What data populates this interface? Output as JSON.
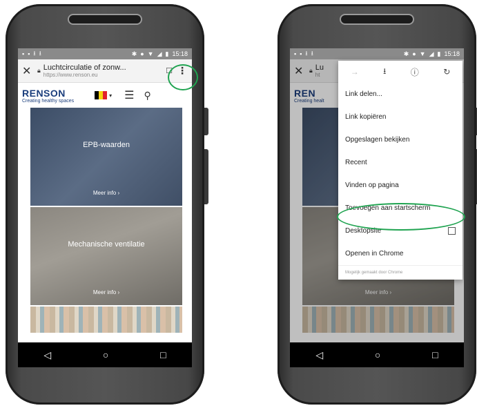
{
  "left": {
    "status": {
      "time": "15:18"
    },
    "urlbar": {
      "title": "Luchtcirculatie of zonw...",
      "host": "https://www.renson.eu"
    },
    "site": {
      "brand": "RENSON",
      "tagline": "Creating healthy spaces"
    },
    "tiles": [
      {
        "title": "EPB-waarden",
        "more": "Meer info ›"
      },
      {
        "title": "Mechanische ventilatie",
        "more": "Meer info ›"
      }
    ]
  },
  "right": {
    "status": {
      "time": "15:18"
    },
    "urlbar": {
      "title": "Lu",
      "host": "ht"
    },
    "site": {
      "brand": "REN",
      "tagline": "Creating healt"
    },
    "tile_more": "Meer info ›",
    "menu": {
      "items": [
        "Link delen...",
        "Link kopiëren",
        "Opgeslagen bekijken",
        "Recent",
        "Vinden op pagina",
        "Toevoegen aan startscherm",
        "Desktopsite",
        "Openen in Chrome"
      ],
      "footer": "Mogelijk gemaakt door Chrome"
    }
  },
  "highlight_color": "#1fa350"
}
